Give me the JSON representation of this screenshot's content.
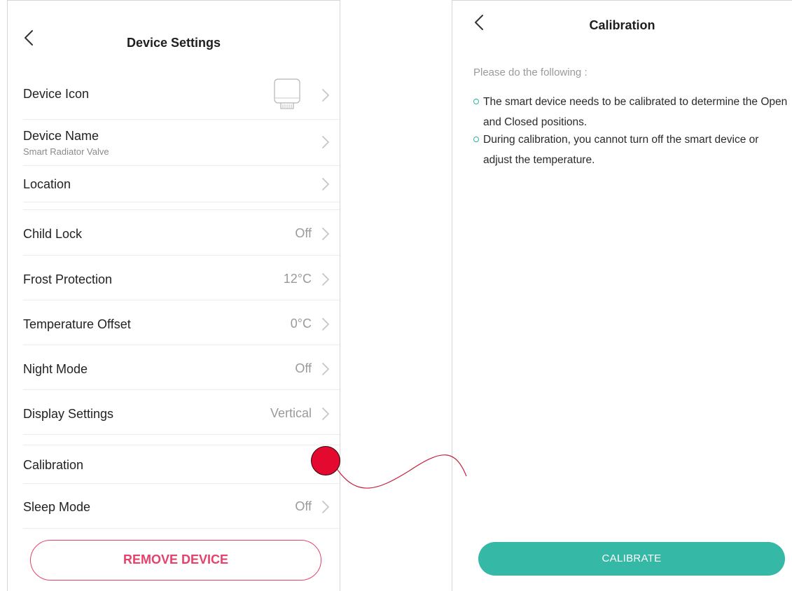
{
  "left": {
    "title": "Device Settings",
    "rows": {
      "device_icon": {
        "label": "Device Icon"
      },
      "device_name": {
        "label": "Device Name",
        "sub": "Smart Radiator Valve"
      },
      "location": {
        "label": "Location"
      },
      "child_lock": {
        "label": "Child Lock",
        "value": "Off"
      },
      "frost_protection": {
        "label": "Frost Protection",
        "value": "12°C"
      },
      "temperature_offset": {
        "label": "Temperature Offset",
        "value": "0°C"
      },
      "night_mode": {
        "label": "Night Mode",
        "value": "Off"
      },
      "display_settings": {
        "label": "Display Settings",
        "value": "Vertical"
      },
      "calibration": {
        "label": "Calibration"
      },
      "sleep_mode": {
        "label": "Sleep Mode",
        "value": "Off"
      }
    },
    "remove_button": "REMOVE DEVICE"
  },
  "right": {
    "title": "Calibration",
    "intro": "Please do the following :",
    "bullets": [
      "The smart device needs to be calibrated to determine the Open and Closed positions.",
      "During calibration, you cannot turn off the smart device or adjust the temperature."
    ],
    "calibrate_button": "CALIBRATE"
  },
  "colors": {
    "accent_red": "#e5426b",
    "accent_teal": "#35b8a6",
    "tap_marker": "#e3092f"
  }
}
